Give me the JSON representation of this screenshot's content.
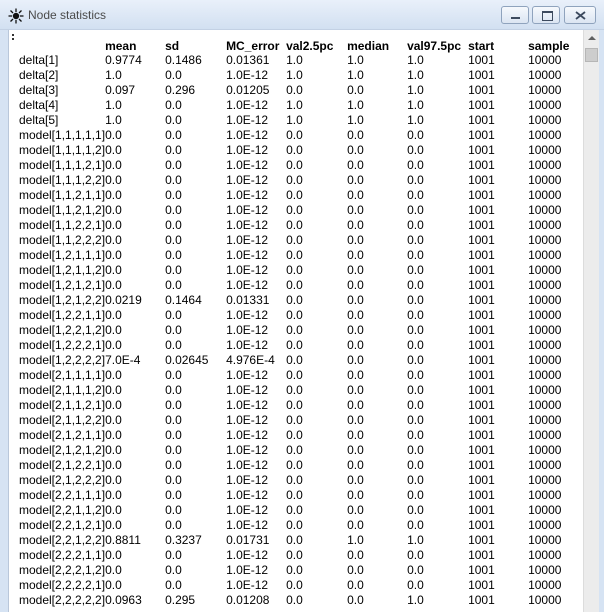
{
  "window": {
    "title": "Node statistics"
  },
  "table": {
    "columns": [
      "",
      "mean",
      "sd",
      "MC_error",
      "val2.5pc",
      "median",
      "val97.5pc",
      "start",
      "sample"
    ],
    "rows": [
      [
        "delta[1]",
        "0.9774",
        "0.1486",
        "0.01361",
        "1.0",
        "1.0",
        "1.0",
        "1001",
        "10000"
      ],
      [
        "delta[2]",
        "1.0",
        "0.0",
        "1.0E-12",
        "1.0",
        "1.0",
        "1.0",
        "1001",
        "10000"
      ],
      [
        "delta[3]",
        "0.097",
        "0.296",
        "0.01205",
        "0.0",
        "0.0",
        "1.0",
        "1001",
        "10000"
      ],
      [
        "delta[4]",
        "1.0",
        "0.0",
        "1.0E-12",
        "1.0",
        "1.0",
        "1.0",
        "1001",
        "10000"
      ],
      [
        "delta[5]",
        "1.0",
        "0.0",
        "1.0E-12",
        "1.0",
        "1.0",
        "1.0",
        "1001",
        "10000"
      ],
      [
        "model[1,1,1,1,1]",
        "0.0",
        "0.0",
        "1.0E-12",
        "0.0",
        "0.0",
        "0.0",
        "1001",
        "10000"
      ],
      [
        "model[1,1,1,1,2]",
        "0.0",
        "0.0",
        "1.0E-12",
        "0.0",
        "0.0",
        "0.0",
        "1001",
        "10000"
      ],
      [
        "model[1,1,1,2,1]",
        "0.0",
        "0.0",
        "1.0E-12",
        "0.0",
        "0.0",
        "0.0",
        "1001",
        "10000"
      ],
      [
        "model[1,1,1,2,2]",
        "0.0",
        "0.0",
        "1.0E-12",
        "0.0",
        "0.0",
        "0.0",
        "1001",
        "10000"
      ],
      [
        "model[1,1,2,1,1]",
        "0.0",
        "0.0",
        "1.0E-12",
        "0.0",
        "0.0",
        "0.0",
        "1001",
        "10000"
      ],
      [
        "model[1,1,2,1,2]",
        "0.0",
        "0.0",
        "1.0E-12",
        "0.0",
        "0.0",
        "0.0",
        "1001",
        "10000"
      ],
      [
        "model[1,1,2,2,1]",
        "0.0",
        "0.0",
        "1.0E-12",
        "0.0",
        "0.0",
        "0.0",
        "1001",
        "10000"
      ],
      [
        "model[1,1,2,2,2]",
        "0.0",
        "0.0",
        "1.0E-12",
        "0.0",
        "0.0",
        "0.0",
        "1001",
        "10000"
      ],
      [
        "model[1,2,1,1,1]",
        "0.0",
        "0.0",
        "1.0E-12",
        "0.0",
        "0.0",
        "0.0",
        "1001",
        "10000"
      ],
      [
        "model[1,2,1,1,2]",
        "0.0",
        "0.0",
        "1.0E-12",
        "0.0",
        "0.0",
        "0.0",
        "1001",
        "10000"
      ],
      [
        "model[1,2,1,2,1]",
        "0.0",
        "0.0",
        "1.0E-12",
        "0.0",
        "0.0",
        "0.0",
        "1001",
        "10000"
      ],
      [
        "model[1,2,1,2,2]",
        "0.0219",
        "0.1464",
        "0.01331",
        "0.0",
        "0.0",
        "0.0",
        "1001",
        "10000"
      ],
      [
        "model[1,2,2,1,1]",
        "0.0",
        "0.0",
        "1.0E-12",
        "0.0",
        "0.0",
        "0.0",
        "1001",
        "10000"
      ],
      [
        "model[1,2,2,1,2]",
        "0.0",
        "0.0",
        "1.0E-12",
        "0.0",
        "0.0",
        "0.0",
        "1001",
        "10000"
      ],
      [
        "model[1,2,2,2,1]",
        "0.0",
        "0.0",
        "1.0E-12",
        "0.0",
        "0.0",
        "0.0",
        "1001",
        "10000"
      ],
      [
        "model[1,2,2,2,2]",
        "7.0E-4",
        "0.02645",
        "4.976E-4",
        "0.0",
        "0.0",
        "0.0",
        "1001",
        "10000"
      ],
      [
        "model[2,1,1,1,1]",
        "0.0",
        "0.0",
        "1.0E-12",
        "0.0",
        "0.0",
        "0.0",
        "1001",
        "10000"
      ],
      [
        "model[2,1,1,1,2]",
        "0.0",
        "0.0",
        "1.0E-12",
        "0.0",
        "0.0",
        "0.0",
        "1001",
        "10000"
      ],
      [
        "model[2,1,1,2,1]",
        "0.0",
        "0.0",
        "1.0E-12",
        "0.0",
        "0.0",
        "0.0",
        "1001",
        "10000"
      ],
      [
        "model[2,1,1,2,2]",
        "0.0",
        "0.0",
        "1.0E-12",
        "0.0",
        "0.0",
        "0.0",
        "1001",
        "10000"
      ],
      [
        "model[2,1,2,1,1]",
        "0.0",
        "0.0",
        "1.0E-12",
        "0.0",
        "0.0",
        "0.0",
        "1001",
        "10000"
      ],
      [
        "model[2,1,2,1,2]",
        "0.0",
        "0.0",
        "1.0E-12",
        "0.0",
        "0.0",
        "0.0",
        "1001",
        "10000"
      ],
      [
        "model[2,1,2,2,1]",
        "0.0",
        "0.0",
        "1.0E-12",
        "0.0",
        "0.0",
        "0.0",
        "1001",
        "10000"
      ],
      [
        "model[2,1,2,2,2]",
        "0.0",
        "0.0",
        "1.0E-12",
        "0.0",
        "0.0",
        "0.0",
        "1001",
        "10000"
      ],
      [
        "model[2,2,1,1,1]",
        "0.0",
        "0.0",
        "1.0E-12",
        "0.0",
        "0.0",
        "0.0",
        "1001",
        "10000"
      ],
      [
        "model[2,2,1,1,2]",
        "0.0",
        "0.0",
        "1.0E-12",
        "0.0",
        "0.0",
        "0.0",
        "1001",
        "10000"
      ],
      [
        "model[2,2,1,2,1]",
        "0.0",
        "0.0",
        "1.0E-12",
        "0.0",
        "0.0",
        "0.0",
        "1001",
        "10000"
      ],
      [
        "model[2,2,1,2,2]",
        "0.8811",
        "0.3237",
        "0.01731",
        "0.0",
        "1.0",
        "1.0",
        "1001",
        "10000"
      ],
      [
        "model[2,2,2,1,1]",
        "0.0",
        "0.0",
        "1.0E-12",
        "0.0",
        "0.0",
        "0.0",
        "1001",
        "10000"
      ],
      [
        "model[2,2,2,1,2]",
        "0.0",
        "0.0",
        "1.0E-12",
        "0.0",
        "0.0",
        "0.0",
        "1001",
        "10000"
      ],
      [
        "model[2,2,2,2,1]",
        "0.0",
        "0.0",
        "1.0E-12",
        "0.0",
        "0.0",
        "0.0",
        "1001",
        "10000"
      ],
      [
        "model[2,2,2,2,2]",
        "0.0963",
        "0.295",
        "0.01208",
        "0.0",
        "0.0",
        "1.0",
        "1001",
        "10000"
      ]
    ]
  }
}
